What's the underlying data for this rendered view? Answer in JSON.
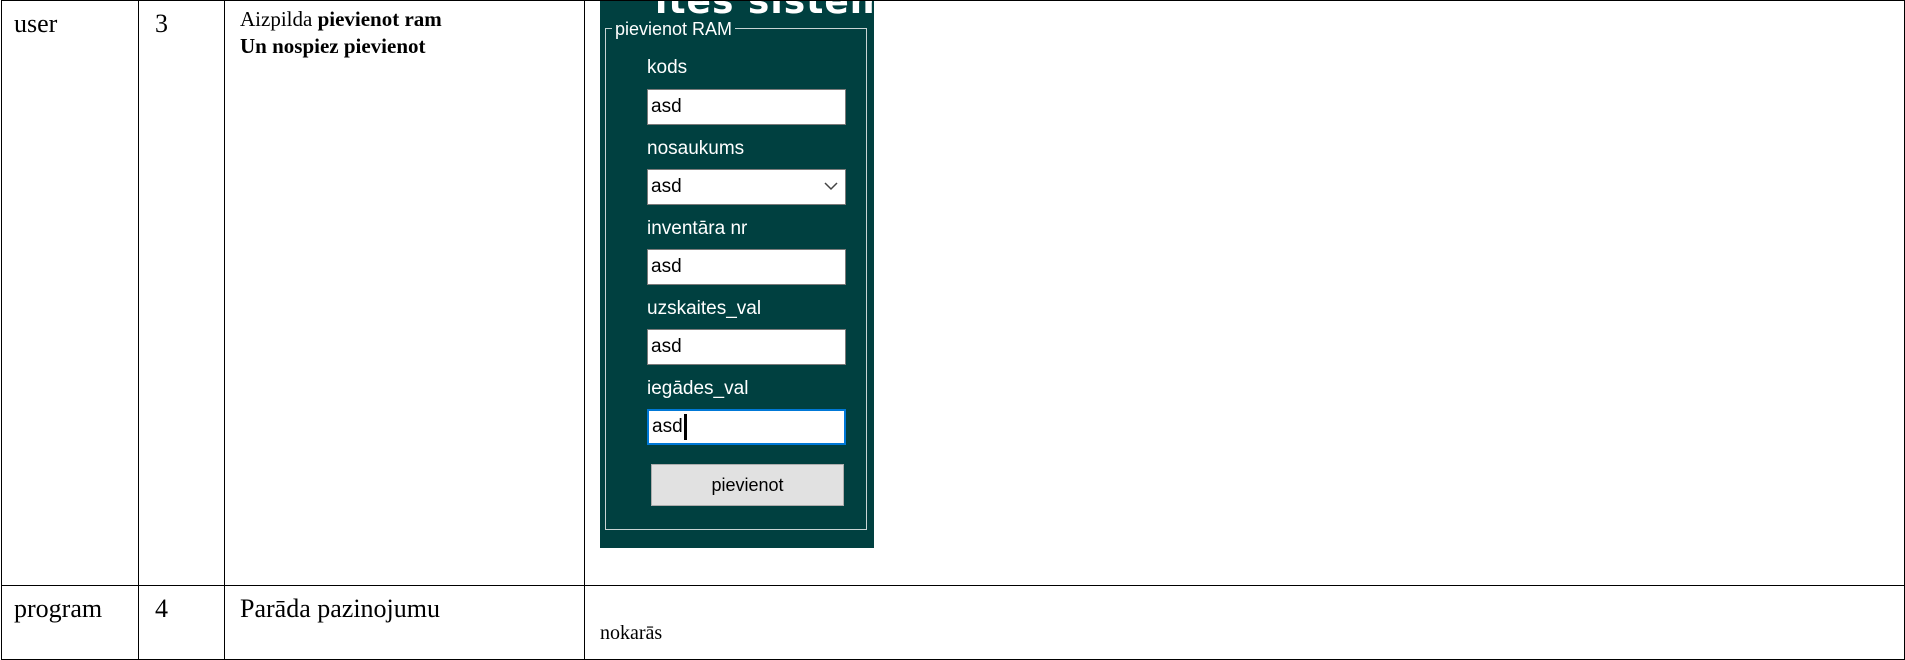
{
  "rows": [
    {
      "actor": "user",
      "step": "3",
      "description": {
        "prefix": "Aizpilda ",
        "bold1": "pievienot ram",
        "bold2": "Un nospiez pievienot"
      }
    },
    {
      "actor": "program",
      "step": "4",
      "description_text": "Parāda pazinojumu",
      "result": "nokarās"
    }
  ],
  "form": {
    "header_fragment": "ites sistēma",
    "group_title": "pievienot RAM",
    "fields": [
      {
        "label": "kods",
        "value": "asd"
      },
      {
        "label": "nosaukums",
        "value": "asd"
      },
      {
        "label": "inventāra nr",
        "value": "asd"
      },
      {
        "label": "uzskaites_val",
        "value": "asd"
      },
      {
        "label": "iegādes_val",
        "value": "asd"
      }
    ],
    "submit_label": "pievienot"
  }
}
